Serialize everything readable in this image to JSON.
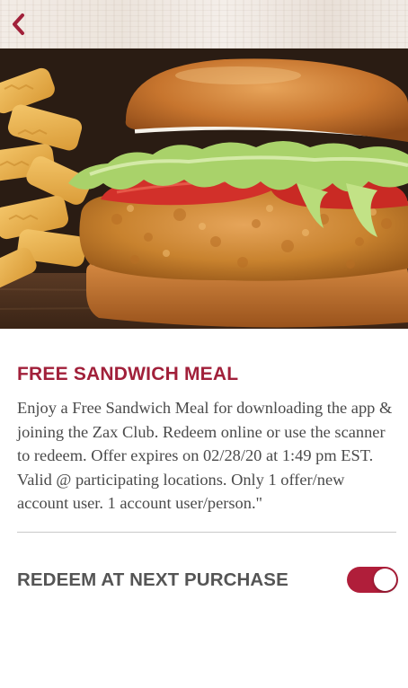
{
  "header": {
    "back_icon": "chevron-left-icon",
    "accent_color": "#a1203a"
  },
  "hero": {
    "image_subject": "chicken sandwich with lettuce and tomato beside crinkle-cut fries"
  },
  "offer": {
    "title": "FREE SANDWICH MEAL",
    "description": "Enjoy a Free Sandwich Meal for downloading the app & joining the Zax Club. Redeem online or use the scanner to redeem. Offer expires on 02/28/20 at 1:49 pm EST. Valid @ participating locations. Only 1 offer/new account user. 1 account user/person.\""
  },
  "redeem": {
    "label": "REDEEM AT NEXT PURCHASE",
    "toggle_on": true,
    "toggle_color": "#b01e3a"
  }
}
